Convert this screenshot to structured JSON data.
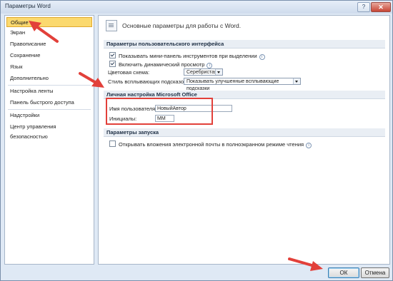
{
  "window": {
    "title": "Параметры Word",
    "help_label": "?",
    "close_label": "✕"
  },
  "sidebar": {
    "items": [
      {
        "label": "Общие",
        "selected": true
      },
      {
        "label": "Экран"
      },
      {
        "label": "Правописание"
      },
      {
        "label": "Сохранение"
      },
      {
        "label": "Язык"
      },
      {
        "label": "Дополнительно"
      },
      {
        "label": "Настройка ленты"
      },
      {
        "label": "Панель быстрого доступа"
      },
      {
        "label": "Надстройки"
      },
      {
        "label": "Центр управления безопасностью"
      }
    ]
  },
  "main": {
    "page_title": "Основные параметры для работы с Word.",
    "ui_section": {
      "header": "Параметры пользовательского интерфейса",
      "mini_toolbar_label": "Показывать мини-панель инструментов при выделении",
      "mini_toolbar_checked": true,
      "live_preview_label": "Включить динамический просмотр",
      "live_preview_checked": true,
      "color_scheme_label": "Цветовая схема:",
      "color_scheme_value": "Серебристая",
      "tooltip_style_label": "Стиль всплывающих подсказок:",
      "tooltip_style_value": "Показывать улучшенные всплывающие подсказки",
      "info_icon": "i"
    },
    "personal_section": {
      "header": "Личная настройка Microsoft Office",
      "username_label": "Имя пользователя:",
      "username_value": "НовыйАвтор",
      "initials_label": "Инициалы:",
      "initials_value": "ММ"
    },
    "startup_section": {
      "header": "Параметры запуска",
      "open_attachments_label": "Открывать вложения электронной почты в полноэкранном режиме чтения",
      "open_attachments_checked": false
    }
  },
  "footer": {
    "ok_label": "ОК",
    "cancel_label": "Отмена"
  },
  "colors": {
    "annotation": "#e2403a",
    "selected_bg": "#fbd96e"
  }
}
